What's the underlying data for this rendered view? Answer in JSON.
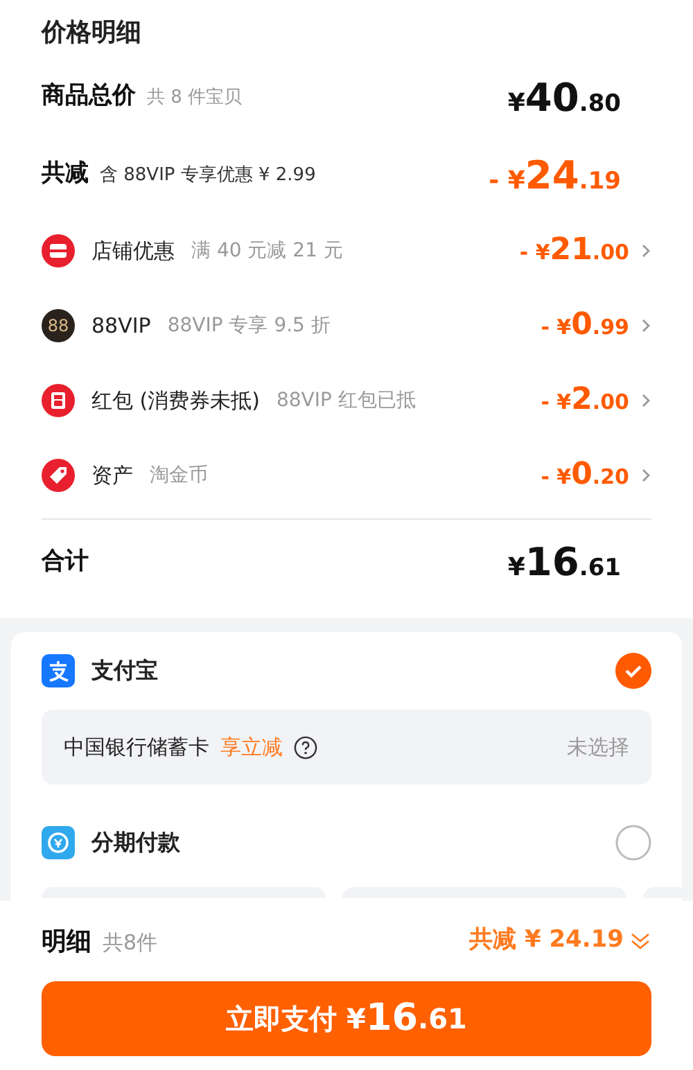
{
  "title": "价格明细",
  "summary": [
    {
      "label": "商品总价",
      "note": "共 8 件宝贝",
      "price": {
        "prefix": "¥",
        "int": "40",
        "dec": ".80"
      },
      "kind": "total"
    },
    {
      "label": "共减",
      "note": "含 88VIP 专享优惠 ¥ 2.99",
      "price": {
        "prefix": "- ¥",
        "int": "24",
        "dec": ".19"
      },
      "kind": "discount"
    }
  ],
  "discounts": [
    {
      "kind": "store",
      "label": "店铺优惠",
      "note": "满 40 元减 21 元",
      "price": {
        "prefix": "- ¥",
        "int": "21",
        "dec": ".00"
      }
    },
    {
      "kind": "vip",
      "icon_text": "88",
      "label": "88VIP",
      "note": "88VIP 专享 9.5 折",
      "price": {
        "prefix": "- ¥",
        "int": "0",
        "dec": ".99"
      }
    },
    {
      "kind": "redpacket",
      "label": "红包 (消费券未抵)",
      "note": "88VIP 红包已抵",
      "price": {
        "prefix": "- ¥",
        "int": "2",
        "dec": ".00"
      }
    },
    {
      "kind": "asset",
      "label": "资产",
      "note": "淘金币",
      "price": {
        "prefix": "- ¥",
        "int": "0",
        "dec": ".20"
      }
    }
  ],
  "grand_total": {
    "label": "合计",
    "price": {
      "prefix": "¥",
      "int": "16",
      "dec": ".61"
    }
  },
  "payment_methods": [
    {
      "kind": "alipay",
      "label": "支付宝",
      "selected": true,
      "card": {
        "name": "中国银行储蓄卡",
        "promo": "享立减",
        "status": "未选择"
      }
    },
    {
      "kind": "installment",
      "label": "分期付款",
      "selected": false
    }
  ],
  "footer": {
    "label": "明细",
    "count": "共8件",
    "saving": "共减 ¥ 24.19"
  },
  "pay_button": {
    "label": "立即支付",
    "prefix": "¥",
    "int": "16",
    "dec": ".61"
  }
}
